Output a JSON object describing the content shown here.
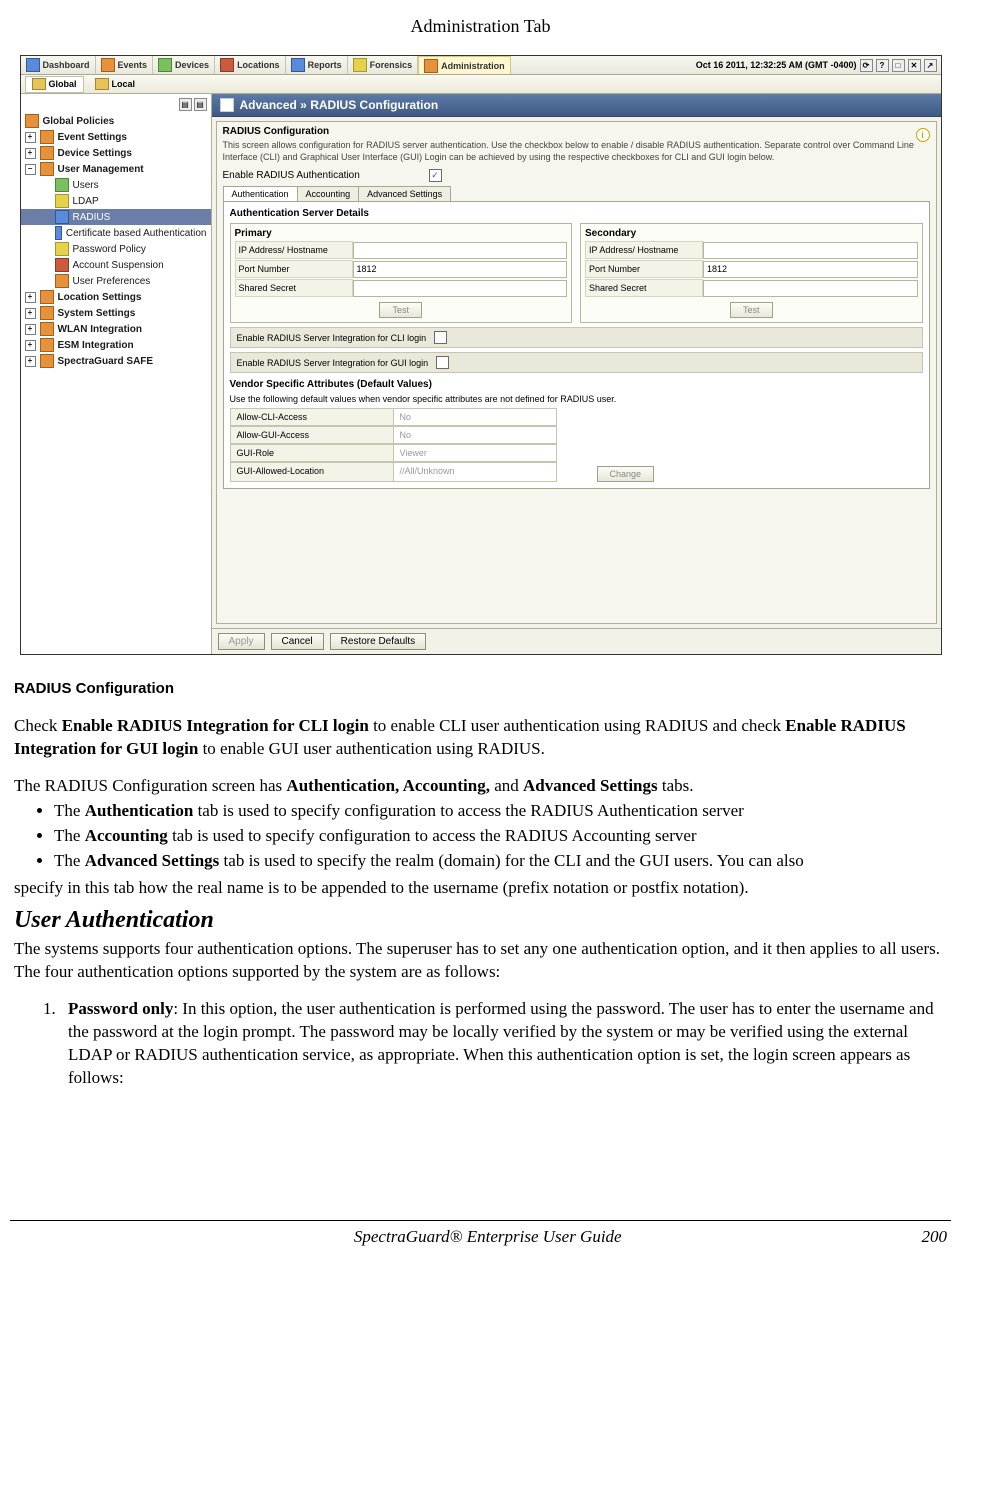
{
  "page_header": "Administration Tab",
  "top_tabs": [
    "Dashboard",
    "Events",
    "Devices",
    "Locations",
    "Reports",
    "Forensics",
    "Administration"
  ],
  "active_top_tab": "Administration",
  "datetime": "Oct 16 2011, 12:32:25 AM (GMT -0400)",
  "subbar": {
    "global": "Global",
    "local": "Local"
  },
  "tree": {
    "global_policies": "Global Policies",
    "event_settings": "Event Settings",
    "device_settings": "Device Settings",
    "user_management": "User Management",
    "users": "Users",
    "ldap": "LDAP",
    "radius": "RADIUS",
    "cert_auth": "Certificate based Authentication",
    "pw_policy": "Password Policy",
    "acct_susp": "Account Suspension",
    "user_prefs": "User Preferences",
    "location_settings": "Location Settings",
    "system_settings": "System Settings",
    "wlan_integration": "WLAN Integration",
    "esm_integration": "ESM Integration",
    "spectraguard_safe": "SpectraGuard SAFE"
  },
  "breadcrumb": "Advanced » RADIUS Configuration",
  "panel": {
    "title": "RADIUS Configuration",
    "desc": "This screen allows configuration for RADIUS server authentication. Use the checkbox below to enable / disable RADIUS authentication. Separate control over Command Line Interface (CLI) and Graphical User Interface (GUI) Login can be achieved by using the respective checkboxes for CLI and GUI login below.",
    "enable_label": "Enable RADIUS Authentication",
    "inner_tabs": [
      "Authentication",
      "Accounting",
      "Advanced Settings"
    ],
    "auth_details_title": "Authentication Server Details",
    "primary": "Primary",
    "secondary": "Secondary",
    "ip": "IP Address/ Hostname",
    "port": "Port Number",
    "port_val": "1812",
    "secret": "Shared Secret",
    "test": "Test",
    "cli_cb": "Enable RADIUS Server Integration for CLI login",
    "gui_cb": "Enable RADIUS Server Integration for GUI login",
    "vendor_title": "Vendor Specific Attributes (Default Values)",
    "vendor_desc": "Use the following default values when vendor specific attributes are not defined for RADIUS user.",
    "v1": {
      "label": "Allow-CLI-Access",
      "val": "No"
    },
    "v2": {
      "label": "Allow-GUI-Access",
      "val": "No"
    },
    "v3": {
      "label": "GUI-Role",
      "val": "Viewer"
    },
    "v4": {
      "label": "GUI-Allowed-Location",
      "val": "//All/Unknown"
    },
    "change": "Change"
  },
  "buttons": {
    "apply": "Apply",
    "cancel": "Cancel",
    "restore": "Restore Defaults"
  },
  "doc": {
    "caption": "RADIUS Configuration",
    "p1a": "Check ",
    "p1b": "Enable RADIUS Integration for CLI login",
    "p1c": " to enable CLI user authentication using RADIUS and check ",
    "p1d": "Enable RADIUS Integration for GUI login",
    "p1e": " to enable GUI user authentication using RADIUS.",
    "p2a": "The RADIUS Configuration screen has ",
    "p2b": "Authentication, Accounting,",
    "p2c": " and ",
    "p2d": "Advanced Settings",
    "p2e": " tabs.",
    "li1a": "The ",
    "li1b": "Authentication",
    "li1c": " tab is used to specify configuration to access the RADIUS Authentication server",
    "li2a": "The ",
    "li2b": "Accounting",
    "li2c": " tab is used to specify configuration to access the RADIUS Accounting server",
    "li3a": "The ",
    "li3b": "Advanced Settings",
    "li3c": " tab is used to specify the realm (domain) for the CLI and the GUI users. You can also",
    "li3_tail": "specify in this tab how the real name is to be appended to the username (prefix notation or postfix notation).",
    "section_title": "User Authentication",
    "p3": "The systems supports four authentication options. The superuser has to set any one authentication option, and it then applies to all users. The four authentication options supported by the system are as follows:",
    "ol1a": "Password only",
    "ol1b": ": In this option, the user authentication is performed using the password. The user has to enter the username and the password at the login prompt. The password may be locally verified by the system or may be verified using the external LDAP or RADIUS authentication service, as appropriate. When this authentication option is set, the login screen appears as follows:"
  },
  "footer": {
    "title": "SpectraGuard® Enterprise User Guide",
    "page": "200"
  }
}
